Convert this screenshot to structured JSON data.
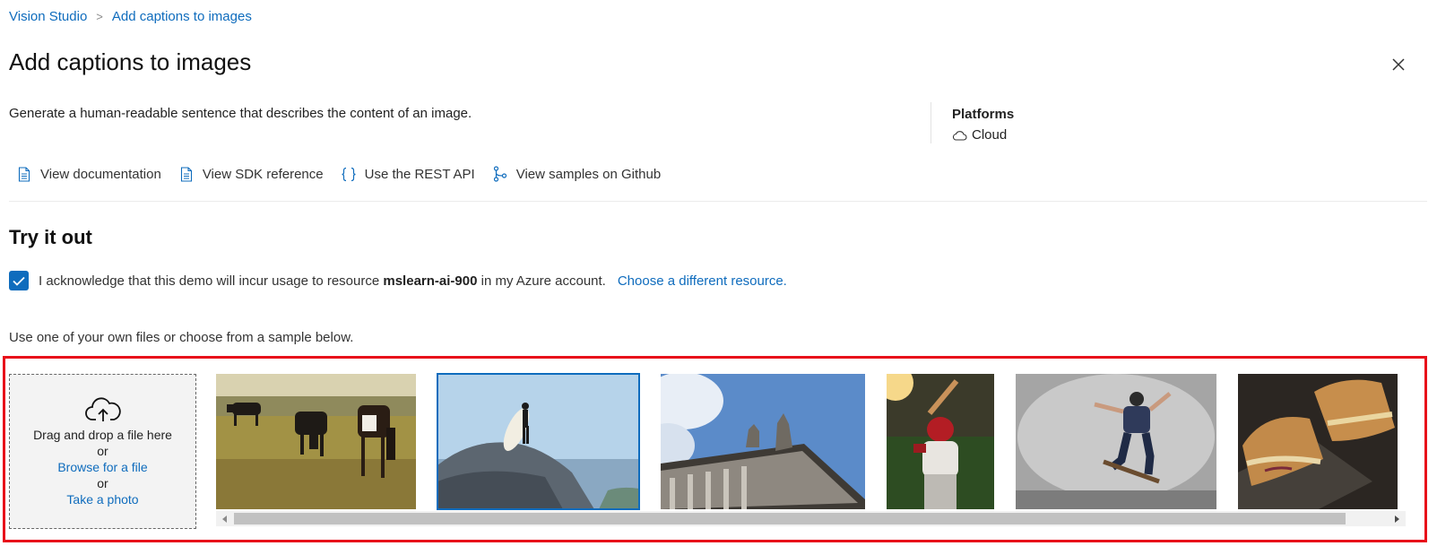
{
  "breadcrumb": {
    "home": "Vision Studio",
    "separator": ">",
    "current": "Add captions to images"
  },
  "page_title": "Add captions to images",
  "description": "Generate a human-readable sentence that describes the content of an image.",
  "platforms": {
    "title": "Platforms",
    "item": "Cloud"
  },
  "links": [
    {
      "label": "View documentation",
      "icon": "document-icon"
    },
    {
      "label": "View SDK reference",
      "icon": "document-icon"
    },
    {
      "label": "Use the REST API",
      "icon": "braces-icon"
    },
    {
      "label": "View samples on Github",
      "icon": "branch-icon"
    }
  ],
  "try_it": {
    "title": "Try it out",
    "ack_prefix": "I acknowledge that this demo will incur usage to resource",
    "resource": "mslearn-ai-900",
    "ack_suffix": "in my Azure account.",
    "change_link": "Choose a different resource.",
    "checked": true
  },
  "use_own": "Use one of your own files or choose from a sample below.",
  "drop": {
    "title": "Drag and drop a file here",
    "or1": "or",
    "browse": "Browse for a file",
    "or2": "or",
    "photo": "Take a photo"
  },
  "samples": [
    {
      "name": "cows-grazing"
    },
    {
      "name": "surfer-on-rock",
      "selected": true
    },
    {
      "name": "building-statues"
    },
    {
      "name": "baseball-batter"
    },
    {
      "name": "skateboarder"
    },
    {
      "name": "toasted-sandwich"
    }
  ],
  "colors": {
    "accent": "#0f6cbd",
    "highlight": "#e8101a"
  }
}
